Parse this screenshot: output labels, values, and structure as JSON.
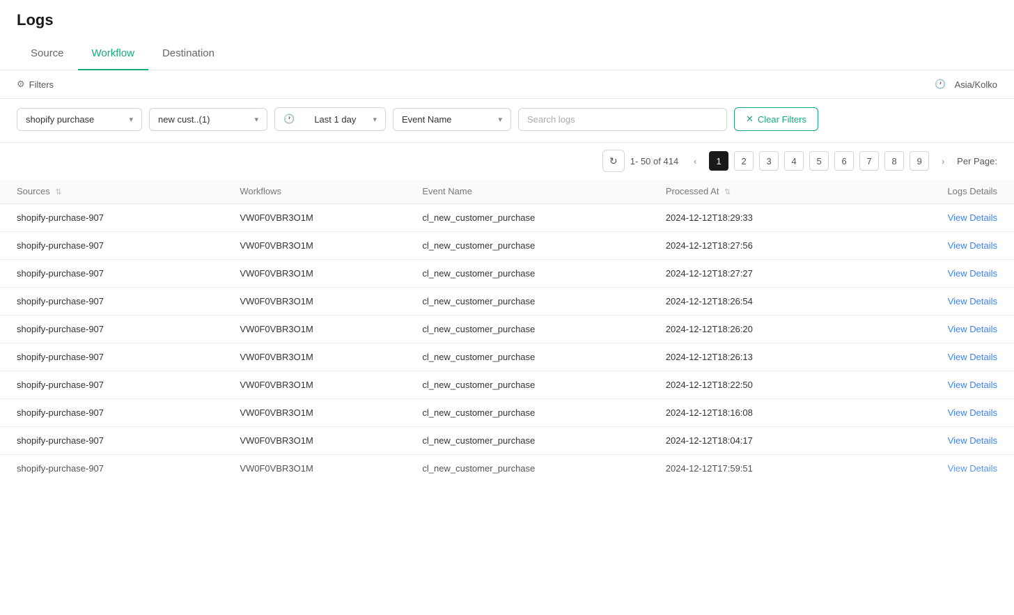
{
  "header": {
    "title": "Logs"
  },
  "tabs": [
    {
      "id": "source",
      "label": "Source",
      "active": false
    },
    {
      "id": "workflow",
      "label": "Workflow",
      "active": true
    },
    {
      "id": "destination",
      "label": "Destination",
      "active": false
    }
  ],
  "filters_label": "Filters",
  "timezone": "Asia/Kolko",
  "filters": {
    "source": {
      "value": "shopify purchase",
      "placeholder": "shopify purchase"
    },
    "workflow": {
      "value": "new cust..(1)",
      "placeholder": "new cust..(1)"
    },
    "time": {
      "value": "Last 1 day",
      "placeholder": "Last 1 day"
    },
    "event": {
      "value": "Event Name",
      "placeholder": "Event Name"
    },
    "search": {
      "placeholder": "Search logs",
      "value": ""
    },
    "clear_label": "Clear Filters"
  },
  "pagination": {
    "refresh_icon": "↻",
    "range": "1- 50 of 414",
    "pages": [
      "1",
      "2",
      "3",
      "4",
      "5",
      "6",
      "7",
      "8",
      "9"
    ],
    "current_page": "1",
    "per_page_label": "Per Page:"
  },
  "table": {
    "columns": [
      {
        "id": "sources",
        "label": "Sources",
        "sortable": true
      },
      {
        "id": "workflows",
        "label": "Workflows",
        "sortable": false
      },
      {
        "id": "event_name",
        "label": "Event Name",
        "sortable": false
      },
      {
        "id": "processed_at",
        "label": "Processed At",
        "sortable": true
      },
      {
        "id": "logs_details",
        "label": "Logs Details",
        "sortable": false
      }
    ],
    "rows": [
      {
        "source": "shopify-purchase-907",
        "workflow": "VW0F0VBR3O1M",
        "event": "cl_new_customer_purchase",
        "processed_at": "2024-12-12T18:29:33",
        "link": "View Details"
      },
      {
        "source": "shopify-purchase-907",
        "workflow": "VW0F0VBR3O1M",
        "event": "cl_new_customer_purchase",
        "processed_at": "2024-12-12T18:27:56",
        "link": "View Details"
      },
      {
        "source": "shopify-purchase-907",
        "workflow": "VW0F0VBR3O1M",
        "event": "cl_new_customer_purchase",
        "processed_at": "2024-12-12T18:27:27",
        "link": "View Details"
      },
      {
        "source": "shopify-purchase-907",
        "workflow": "VW0F0VBR3O1M",
        "event": "cl_new_customer_purchase",
        "processed_at": "2024-12-12T18:26:54",
        "link": "View Details"
      },
      {
        "source": "shopify-purchase-907",
        "workflow": "VW0F0VBR3O1M",
        "event": "cl_new_customer_purchase",
        "processed_at": "2024-12-12T18:26:20",
        "link": "View Details"
      },
      {
        "source": "shopify-purchase-907",
        "workflow": "VW0F0VBR3O1M",
        "event": "cl_new_customer_purchase",
        "processed_at": "2024-12-12T18:26:13",
        "link": "View Details"
      },
      {
        "source": "shopify-purchase-907",
        "workflow": "VW0F0VBR3O1M",
        "event": "cl_new_customer_purchase",
        "processed_at": "2024-12-12T18:22:50",
        "link": "View Details"
      },
      {
        "source": "shopify-purchase-907",
        "workflow": "VW0F0VBR3O1M",
        "event": "cl_new_customer_purchase",
        "processed_at": "2024-12-12T18:16:08",
        "link": "View Details"
      },
      {
        "source": "shopify-purchase-907",
        "workflow": "VW0F0VBR3O1M",
        "event": "cl_new_customer_purchase",
        "processed_at": "2024-12-12T18:04:17",
        "link": "View Details"
      },
      {
        "source": "shopify-purchase-907",
        "workflow": "VW0F0VBR3O1M",
        "event": "cl_new_customer_purchase",
        "processed_at": "2024-12-12T17:59:51",
        "link": "View Details"
      }
    ]
  }
}
